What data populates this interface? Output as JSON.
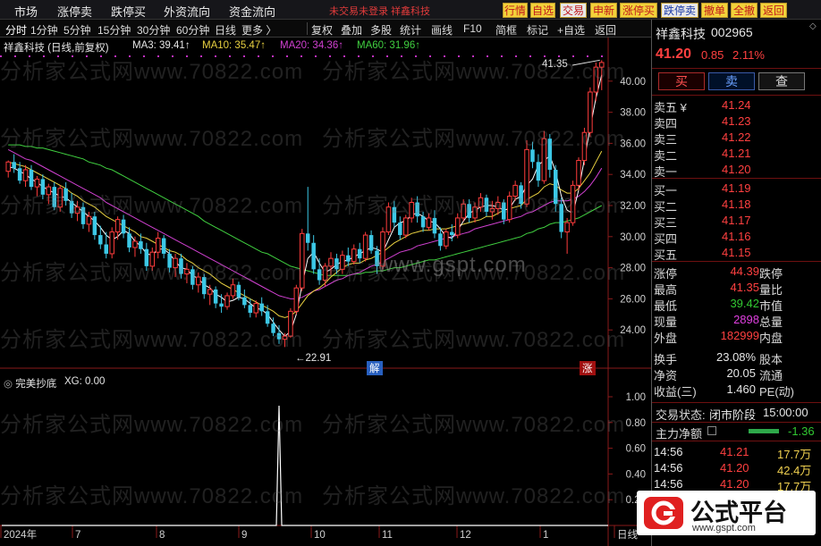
{
  "menu": [
    "市场",
    "涨停卖",
    "跌停买",
    "外资流向",
    "资金流向"
  ],
  "login_warning": "未交易未登录  祥鑫科技",
  "quick_buttons": [
    "行情",
    "自选",
    "交易",
    "申新",
    "涨停买",
    "跌停卖",
    "撤单",
    "全撤",
    "返回"
  ],
  "toolbar": {
    "periods": [
      "分时",
      "1分钟",
      "5分钟",
      "15分钟",
      "30分钟",
      "60分钟",
      "日线",
      "更多 〉"
    ],
    "tools": [
      "复权",
      "叠加",
      "多股",
      "统计",
      "画线",
      "F10",
      "简框",
      "标记",
      "+自选",
      "返回"
    ]
  },
  "legend": {
    "stock": "祥鑫科技 (日线,前复权)",
    "ma3": "MA3: 39.41↑",
    "ma10": "MA10: 35.47↑",
    "ma20": "MA20: 34.36↑",
    "ma60": "MA60: 31.96↑",
    "indicator": "完美抄底",
    "xg": "XG: 0.00"
  },
  "annotations": {
    "high": "41.35",
    "low": "←22.91",
    "jie": "解",
    "zhang": "涨"
  },
  "watermark_text": "分析家公式网www.70822.com",
  "site_watermark": "www.gspt.com",
  "stock": {
    "name": "祥鑫科技",
    "code": "002965",
    "price": "41.20",
    "change": "0.85",
    "pct": "2.11%"
  },
  "trade_buttons": [
    "买",
    "卖",
    "查"
  ],
  "asks": [
    {
      "label": "卖五",
      "mark": "¥",
      "price": "41.24",
      "vol": ""
    },
    {
      "label": "卖四",
      "mark": "",
      "price": "41.23",
      "vol": ""
    },
    {
      "label": "卖三",
      "mark": "",
      "price": "41.22",
      "vol": ""
    },
    {
      "label": "卖二",
      "mark": "",
      "price": "41.21",
      "vol": ""
    },
    {
      "label": "卖一",
      "mark": "",
      "price": "41.20",
      "vol": ""
    }
  ],
  "bids": [
    {
      "label": "买一",
      "price": "41.19"
    },
    {
      "label": "买二",
      "price": "41.18"
    },
    {
      "label": "买三",
      "price": "41.17"
    },
    {
      "label": "买四",
      "price": "41.16"
    },
    {
      "label": "买五",
      "price": "41.15"
    }
  ],
  "stats": [
    {
      "l1": "涨停",
      "v1": "44.39",
      "c1": "red",
      "l2": "跌停"
    },
    {
      "l1": "最高",
      "v1": "41.35",
      "c1": "red",
      "l2": "量比"
    },
    {
      "l1": "最低",
      "v1": "39.42",
      "c1": "grn",
      "l2": "市值"
    },
    {
      "l1": "现量",
      "v1": "2898",
      "c1": "mag",
      "l2": "总量"
    },
    {
      "l1": "外盘",
      "v1": "182999",
      "c1": "red",
      "l2": "内盘"
    },
    {
      "l1": "换手",
      "v1": "23.08%",
      "c1": "wht",
      "l2": "股本"
    },
    {
      "l1": "净资",
      "v1": "20.05",
      "c1": "wht",
      "l2": "流通"
    },
    {
      "l1": "收益(三)",
      "v1": "1.460",
      "c1": "wht",
      "l2": "PE(动)"
    }
  ],
  "status": {
    "label": "交易状态:",
    "value": "闭市阶段",
    "time": "15:00:00"
  },
  "main_flow": {
    "label": "主力净额",
    "value": "-1.36"
  },
  "ticks": [
    {
      "time": "14:56",
      "price": "41.21",
      "vol": "17.7万"
    },
    {
      "time": "14:56",
      "price": "41.20",
      "vol": "42.4万"
    },
    {
      "time": "14:56",
      "price": "41.20",
      "vol": "17.7万"
    }
  ],
  "logo_text": "公式平台",
  "logo_url": "www.gspt.com",
  "price_axis": [
    "40.00",
    "38.00",
    "36.00",
    "34.00",
    "32.00",
    "30.00",
    "28.00",
    "26.00",
    "24.00"
  ],
  "indicator_axis": [
    "1.00",
    "0.80",
    "0.60",
    "0.40",
    "0.20"
  ],
  "date_axis": [
    "2024年",
    "7",
    "8",
    "9",
    "10",
    "11",
    "12",
    "1",
    "日线"
  ],
  "colors": {
    "up": "#ff3c3c",
    "down": "#3cc8e6",
    "ma3": "#ffffff",
    "ma10": "#e8d040",
    "ma20": "#d040d0",
    "ma60": "#40d040"
  },
  "chart_data": {
    "type": "candlestick",
    "ylim": [
      22,
      42
    ],
    "candles": [
      [
        34.2,
        34.9,
        33.8,
        34.8
      ],
      [
        34.8,
        35.3,
        34.1,
        34.4
      ],
      [
        34.4,
        34.8,
        33.4,
        33.6
      ],
      [
        33.6,
        34.6,
        33.2,
        34.3
      ],
      [
        34.3,
        34.6,
        33.0,
        33.2
      ],
      [
        33.2,
        33.9,
        32.6,
        33.7
      ],
      [
        33.7,
        34.0,
        32.4,
        32.7
      ],
      [
        32.7,
        33.4,
        32.1,
        33.2
      ],
      [
        33.2,
        33.5,
        31.7,
        31.9
      ],
      [
        31.9,
        33.3,
        31.6,
        33.1
      ],
      [
        33.1,
        33.5,
        32.0,
        32.3
      ],
      [
        32.3,
        32.8,
        31.2,
        31.5
      ],
      [
        31.5,
        32.3,
        31.0,
        31.9
      ],
      [
        31.9,
        32.2,
        30.5,
        30.8
      ],
      [
        30.8,
        31.6,
        30.3,
        31.3
      ],
      [
        31.3,
        31.6,
        29.8,
        30.1
      ],
      [
        30.1,
        30.7,
        29.2,
        29.5
      ],
      [
        29.5,
        30.3,
        28.6,
        28.9
      ],
      [
        28.9,
        30.6,
        28.6,
        30.3
      ],
      [
        30.3,
        31.3,
        29.8,
        31.1
      ],
      [
        31.1,
        31.4,
        29.9,
        30.2
      ],
      [
        30.2,
        30.6,
        29.0,
        29.3
      ],
      [
        29.3,
        30.0,
        28.7,
        29.7
      ],
      [
        29.7,
        30.2,
        28.9,
        29.2
      ],
      [
        29.2,
        29.6,
        27.8,
        28.1
      ],
      [
        28.1,
        29.3,
        27.8,
        29.0
      ],
      [
        29.0,
        30.3,
        28.6,
        29.9
      ],
      [
        29.9,
        30.1,
        28.6,
        28.9
      ],
      [
        28.9,
        29.2,
        27.7,
        28.0
      ],
      [
        28.0,
        28.9,
        27.4,
        28.6
      ],
      [
        28.6,
        28.9,
        27.3,
        27.6
      ],
      [
        27.6,
        28.3,
        27.0,
        27.9
      ],
      [
        27.9,
        28.1,
        26.6,
        26.9
      ],
      [
        26.9,
        27.7,
        26.4,
        27.4
      ],
      [
        27.4,
        27.6,
        26.0,
        26.3
      ],
      [
        26.3,
        26.9,
        25.6,
        26.6
      ],
      [
        26.6,
        26.8,
        25.4,
        25.7
      ],
      [
        25.7,
        26.3,
        25.1,
        25.5
      ],
      [
        25.5,
        26.4,
        25.3,
        26.2
      ],
      [
        26.2,
        27.3,
        26.0,
        26.9
      ],
      [
        26.9,
        27.1,
        25.9,
        26.1
      ],
      [
        26.1,
        26.6,
        25.4,
        25.6
      ],
      [
        25.6,
        26.0,
        24.8,
        25.1
      ],
      [
        25.1,
        25.9,
        24.8,
        25.7
      ],
      [
        25.7,
        26.1,
        24.9,
        25.2
      ],
      [
        25.2,
        25.6,
        24.2,
        24.4
      ],
      [
        24.4,
        24.8,
        23.6,
        23.8
      ],
      [
        23.8,
        24.3,
        23.1,
        23.4
      ],
      [
        23.4,
        23.8,
        22.9,
        23.6
      ],
      [
        23.6,
        25.4,
        23.5,
        25.2
      ],
      [
        25.2,
        26.9,
        25.0,
        26.7
      ],
      [
        26.7,
        30.5,
        26.5,
        30.2
      ],
      [
        30.2,
        33.2,
        29.1,
        29.6
      ],
      [
        29.6,
        30.1,
        27.6,
        27.9
      ],
      [
        27.9,
        28.6,
        26.9,
        27.2
      ],
      [
        27.2,
        28.3,
        26.8,
        28.1
      ],
      [
        28.1,
        29.0,
        27.5,
        28.6
      ],
      [
        28.6,
        28.9,
        27.6,
        27.9
      ],
      [
        27.9,
        29.1,
        27.6,
        28.8
      ],
      [
        28.8,
        29.3,
        28.1,
        28.4
      ],
      [
        28.4,
        29.5,
        28.2,
        29.2
      ],
      [
        29.2,
        29.6,
        28.3,
        28.6
      ],
      [
        28.6,
        30.3,
        28.4,
        30.1
      ],
      [
        30.1,
        30.4,
        28.9,
        29.1
      ],
      [
        29.1,
        29.4,
        27.6,
        28.1
      ],
      [
        28.1,
        30.6,
        27.9,
        30.3
      ],
      [
        30.3,
        32.2,
        30.1,
        31.9
      ],
      [
        31.9,
        32.3,
        30.6,
        30.9
      ],
      [
        30.9,
        31.3,
        29.8,
        30.1
      ],
      [
        30.1,
        31.4,
        29.9,
        31.2
      ],
      [
        31.2,
        32.5,
        30.9,
        32.2
      ],
      [
        32.2,
        32.6,
        30.9,
        31.3
      ],
      [
        31.3,
        31.6,
        30.3,
        30.6
      ],
      [
        30.6,
        31.5,
        30.4,
        31.2
      ],
      [
        31.2,
        31.7,
        29.9,
        30.2
      ],
      [
        30.2,
        30.6,
        29.1,
        29.4
      ],
      [
        29.4,
        30.5,
        29.2,
        30.3
      ],
      [
        30.3,
        30.8,
        29.7,
        30.1
      ],
      [
        30.1,
        31.5,
        29.9,
        31.2
      ],
      [
        31.2,
        32.4,
        31.0,
        32.1
      ],
      [
        32.1,
        32.4,
        30.9,
        31.2
      ],
      [
        31.2,
        32.2,
        30.9,
        31.9
      ],
      [
        31.9,
        32.8,
        31.6,
        32.5
      ],
      [
        32.5,
        32.7,
        31.3,
        31.6
      ],
      [
        31.6,
        32.3,
        31.1,
        31.8
      ],
      [
        31.8,
        32.6,
        31.4,
        32.2
      ],
      [
        32.2,
        32.4,
        30.8,
        31.1
      ],
      [
        31.1,
        32.9,
        30.9,
        32.6
      ],
      [
        32.6,
        33.6,
        32.3,
        33.3
      ],
      [
        33.3,
        33.5,
        31.8,
        32.1
      ],
      [
        32.1,
        36.2,
        31.9,
        35.6
      ],
      [
        35.6,
        36.1,
        34.4,
        34.8
      ],
      [
        34.8,
        35.3,
        33.2,
        33.6
      ],
      [
        33.6,
        36.8,
        33.4,
        36.3
      ],
      [
        36.3,
        36.6,
        33.8,
        34.3
      ],
      [
        34.3,
        34.6,
        31.6,
        32.1
      ],
      [
        32.1,
        32.5,
        29.9,
        30.3
      ],
      [
        30.3,
        31.2,
        28.9,
        30.9
      ],
      [
        30.9,
        33.6,
        30.7,
        33.3
      ],
      [
        33.3,
        35.1,
        33.0,
        34.9
      ],
      [
        34.9,
        37.0,
        34.6,
        36.7
      ],
      [
        36.7,
        39.6,
        36.4,
        39.3
      ],
      [
        39.3,
        41.2,
        38.7,
        40.9
      ],
      [
        40.9,
        41.35,
        39.42,
        41.2
      ]
    ],
    "ma3": [
      34.5,
      34.4,
      34.2,
      34.0,
      33.7,
      33.5,
      33.2,
      33.0,
      32.8,
      32.6,
      32.5,
      32.2,
      31.9,
      31.6,
      31.3,
      31.0,
      30.6,
      30.1,
      29.8,
      30.0,
      30.4,
      30.2,
      29.7,
      29.4,
      28.9,
      28.8,
      29.2,
      29.2,
      28.9,
      28.4,
      28.0,
      27.9,
      27.5,
      27.3,
      26.9,
      26.7,
      26.3,
      26.1,
      25.8,
      25.9,
      26.1,
      26.0,
      25.7,
      25.4,
      25.3,
      25.0,
      24.5,
      24.0,
      23.6,
      23.9,
      25.0,
      26.9,
      28.6,
      29.0,
      28.3,
      27.7,
      27.9,
      28.2,
      28.4,
      28.5,
      28.7,
      28.9,
      29.1,
      29.3,
      29.2,
      29.0,
      29.8,
      30.6,
      30.9,
      31.0,
      31.4,
      31.5,
      31.3,
      31.0,
      30.9,
      30.5,
      30.0,
      29.9,
      30.4,
      31.0,
      31.5,
      31.7,
      31.9,
      32.0,
      32.0,
      31.9,
      31.7,
      31.8,
      32.4,
      32.6,
      33.3,
      33.7,
      34.6,
      34.9,
      35.2,
      34.2,
      32.6,
      31.7,
      31.5,
      33.0,
      35.0,
      37.0,
      38.9,
      40.4
    ],
    "ma10": [
      34.8,
      34.7,
      34.6,
      34.5,
      34.3,
      34.1,
      33.9,
      33.7,
      33.5,
      33.3,
      33.1,
      32.8,
      32.6,
      32.3,
      32.1,
      31.9,
      31.6,
      31.3,
      31.1,
      30.9,
      30.7,
      30.5,
      30.3,
      30.0,
      29.9,
      29.7,
      29.5,
      29.3,
      29.1,
      29.0,
      28.8,
      28.5,
      28.3,
      28.0,
      27.8,
      27.6,
      27.3,
      27.0,
      26.8,
      26.6,
      26.4,
      26.2,
      26.0,
      25.8,
      25.6,
      25.4,
      25.2,
      24.9,
      24.8,
      24.9,
      25.2,
      25.7,
      26.2,
      26.5,
      26.7,
      27.0,
      27.4,
      27.7,
      28.0,
      28.2,
      28.3,
      28.3,
      28.5,
      28.6,
      28.8,
      29.0,
      29.3,
      29.6,
      29.8,
      30.0,
      30.2,
      30.3,
      30.4,
      30.4,
      30.5,
      30.5,
      30.5,
      30.6,
      30.7,
      30.8,
      30.9,
      31.0,
      31.1,
      31.3,
      31.3,
      31.5,
      31.7,
      31.8,
      31.9,
      32.0,
      32.4,
      32.6,
      32.8,
      33.2,
      33.4,
      33.3,
      33.0,
      32.8,
      32.8,
      33.1,
      33.6,
      34.1,
      34.8,
      35.5
    ],
    "ma20": [
      35.6,
      35.4,
      35.2,
      35.0,
      34.9,
      34.7,
      34.5,
      34.3,
      34.1,
      33.9,
      33.7,
      33.5,
      33.3,
      33.1,
      32.9,
      32.7,
      32.5,
      32.2,
      32.0,
      31.8,
      31.6,
      31.4,
      31.2,
      31.0,
      30.8,
      30.6,
      30.4,
      30.2,
      30.0,
      29.8,
      29.6,
      29.4,
      29.2,
      29.0,
      28.8,
      28.6,
      28.4,
      28.2,
      28.0,
      27.8,
      27.6,
      27.4,
      27.2,
      27.0,
      26.8,
      26.6,
      26.4,
      26.2,
      26.1,
      26.0,
      26.0,
      26.1,
      26.3,
      26.5,
      26.6,
      26.8,
      27.0,
      27.2,
      27.3,
      27.5,
      27.6,
      27.7,
      27.9,
      28.1,
      28.2,
      28.4,
      28.6,
      28.8,
      29.0,
      29.1,
      29.2,
      29.4,
      29.5,
      29.6,
      29.7,
      29.8,
      29.9,
      30.0,
      30.1,
      30.2,
      30.3,
      30.5,
      30.6,
      30.7,
      30.8,
      30.9,
      31.0,
      31.1,
      31.2,
      31.3,
      31.5,
      31.6,
      31.8,
      32.0,
      32.2,
      32.3,
      32.3,
      32.3,
      32.4,
      32.6,
      32.9,
      33.3,
      33.8,
      34.4
    ],
    "ma60": [
      35.9,
      35.9,
      35.9,
      35.8,
      35.8,
      35.7,
      35.7,
      35.6,
      35.5,
      35.4,
      35.3,
      35.2,
      35.1,
      35.0,
      34.8,
      34.7,
      34.6,
      34.4,
      34.3,
      34.1,
      33.9,
      33.7,
      33.5,
      33.3,
      33.1,
      32.9,
      32.7,
      32.5,
      32.3,
      32.1,
      31.9,
      31.7,
      31.5,
      31.3,
      31.0,
      30.8,
      30.6,
      30.4,
      30.2,
      30.0,
      29.8,
      29.6,
      29.4,
      29.2,
      29.0,
      28.9,
      28.7,
      28.5,
      28.3,
      28.1,
      28.0,
      27.9,
      27.8,
      27.7,
      27.6,
      27.5,
      27.5,
      27.5,
      27.5,
      27.5,
      27.6,
      27.6,
      27.7,
      27.7,
      27.8,
      27.8,
      27.9,
      28.0,
      28.0,
      28.1,
      28.2,
      28.3,
      28.4,
      28.5,
      28.5,
      28.6,
      28.7,
      28.8,
      28.9,
      29.0,
      29.1,
      29.2,
      29.3,
      29.4,
      29.5,
      29.6,
      29.7,
      29.8,
      29.9,
      30.0,
      30.2,
      30.3,
      30.5,
      30.6,
      30.8,
      30.9,
      30.9,
      31.0,
      31.1,
      31.2,
      31.4,
      31.6,
      31.8,
      32.0
    ],
    "xg_signal_index": 47,
    "xg_last": 0.0
  }
}
